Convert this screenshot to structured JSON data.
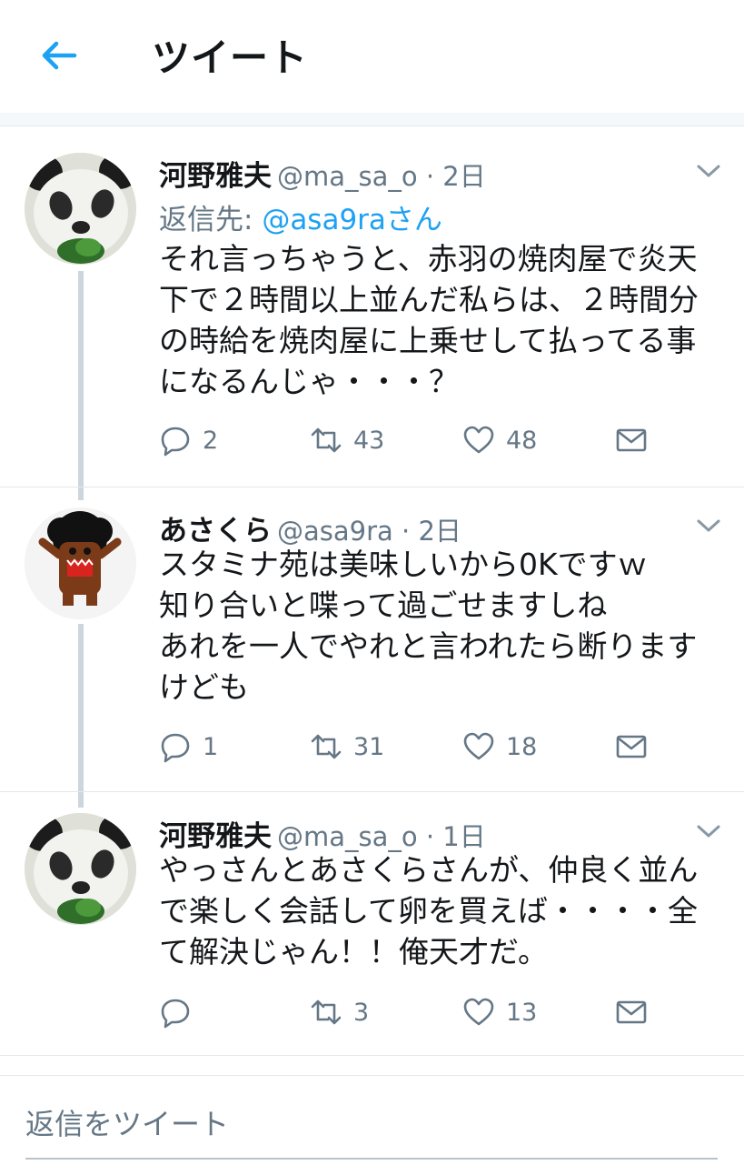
{
  "header": {
    "title": "ツイート"
  },
  "tweets": [
    {
      "name": "河野雅夫",
      "handle": "@ma_sa_o · 2日",
      "reply_to_label": "返信先: ",
      "reply_to_mention": "@asa9raさん",
      "text": "それ言っちゃうと、赤羽の焼肉屋で炎天\n下で２時間以上並んだ私らは、２時間分\nの時給を焼肉屋に上乗せして払ってる事\nになるんじゃ・・・？",
      "replies": "2",
      "retweets": "43",
      "likes": "48",
      "avatar": "panda-avatar"
    },
    {
      "name": "あさくら",
      "handle": "@asa9ra · 2日",
      "text": "スタミナ苑は美味しいから0Kですｗ\n知り合いと喋って過ごせますしね\nあれを一人でやれと言われたら断ります\nけども",
      "replies": "1",
      "retweets": "31",
      "likes": "18",
      "avatar": "domo-avatar"
    },
    {
      "name": "河野雅夫",
      "handle": "@ma_sa_o · 1日",
      "text": "やっさんとあさくらさんが、仲良く並ん\nで楽しく会話して卵を買えば・・・・全\nて解決じゃん！！俺天才だ。",
      "replies": "",
      "retweets": "3",
      "likes": "13",
      "avatar": "panda-avatar"
    }
  ],
  "reply_bar": {
    "placeholder": "返信をツイート"
  },
  "colors": {
    "accent": "#1da1f2",
    "secondary_text": "#657786",
    "thread_line": "#cdd6dd"
  }
}
